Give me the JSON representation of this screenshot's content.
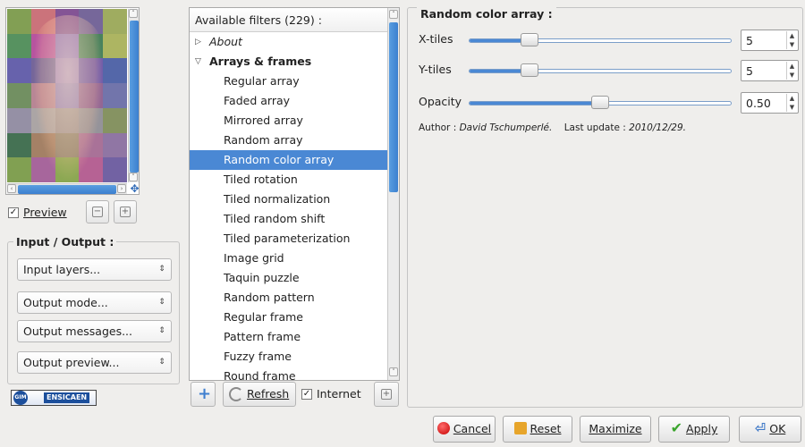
{
  "preview": {
    "checkbox_label": "Preview",
    "checked": true,
    "tile_colors": [
      "#7b9a4b",
      "#c86b74",
      "#7d4b8f",
      "#6f5f95",
      "#9aa857",
      "#4e8c57",
      "#b34b9a",
      "#8a6fb7",
      "#3f7b54",
      "#a9b15a",
      "#5f5aa8",
      "#6e5e95",
      "#9b7fb9",
      "#6d54a3",
      "#4b5fa4",
      "#6a8a5a",
      "#b47f8f",
      "#8c79b3",
      "#8d5e8e",
      "#6a6ea6",
      "#8f8aa0",
      "#a6a0a0",
      "#9a8f8f",
      "#8f8d95",
      "#7f8d5a",
      "#3b6a4b",
      "#9f7a5e",
      "#8b7f6a",
      "#a46a92",
      "#8a6f9f",
      "#7a9b49",
      "#a25e97",
      "#86a34a",
      "#b25a8e",
      "#6a5a9e"
    ]
  },
  "io": {
    "title": "Input / Output :",
    "input_layers": "Input layers...",
    "output_mode": "Output mode...",
    "output_messages": "Output messages...",
    "output_preview": "Output preview..."
  },
  "logo": {
    "circle_text": "GIM",
    "word": "ENSICAEN"
  },
  "filters": {
    "header": "Available filters (229) :",
    "tree": [
      {
        "type": "category",
        "label": "About",
        "expanded": false
      },
      {
        "type": "category",
        "label": "Arrays & frames",
        "expanded": true
      },
      {
        "type": "item",
        "label": "Regular array"
      },
      {
        "type": "item",
        "label": "Faded array"
      },
      {
        "type": "item",
        "label": "Mirrored array"
      },
      {
        "type": "item",
        "label": "Random array"
      },
      {
        "type": "item",
        "label": "Random color array",
        "selected": true
      },
      {
        "type": "item",
        "label": "Tiled rotation"
      },
      {
        "type": "item",
        "label": "Tiled normalization"
      },
      {
        "type": "item",
        "label": "Tiled random shift"
      },
      {
        "type": "item",
        "label": "Tiled parameterization"
      },
      {
        "type": "item",
        "label": "Image grid"
      },
      {
        "type": "item",
        "label": "Taquin puzzle"
      },
      {
        "type": "item",
        "label": "Random pattern"
      },
      {
        "type": "item",
        "label": "Regular frame"
      },
      {
        "type": "item",
        "label": "Pattern frame"
      },
      {
        "type": "item",
        "label": "Fuzzy frame"
      },
      {
        "type": "item",
        "label": "Round frame"
      }
    ],
    "refresh_label": "Refresh",
    "internet_label": "Internet",
    "internet_checked": true
  },
  "params": {
    "title": "Random color array :",
    "rows": [
      {
        "label": "X-tiles",
        "value": "5",
        "fraction": 0.23
      },
      {
        "label": "Y-tiles",
        "value": "5",
        "fraction": 0.23
      },
      {
        "label": "Opacity",
        "value": "0.50",
        "fraction": 0.5
      }
    ],
    "author_prefix": "Author :",
    "author": "David Tschumperlé.",
    "update_prefix": "Last update :",
    "update": "2010/12/29."
  },
  "buttons": {
    "cancel": "Cancel",
    "reset": "Reset",
    "maximize": "Maximize",
    "apply": "Apply",
    "ok": "OK"
  }
}
